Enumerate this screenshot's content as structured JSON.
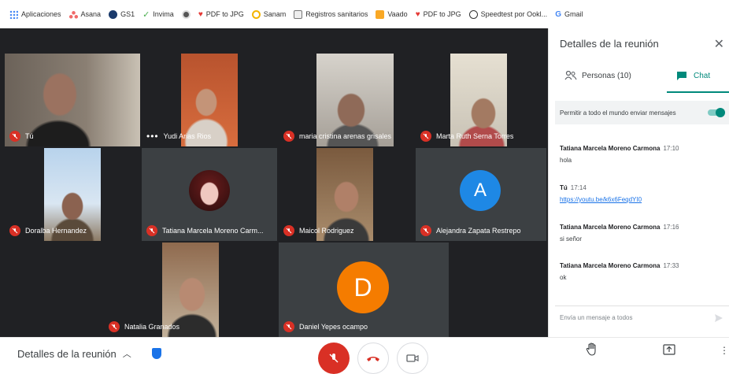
{
  "bookmarks": [
    {
      "label": "Aplicaciones",
      "icon": "apps-grid-icon",
      "color": "#4285f4"
    },
    {
      "label": "Asana",
      "icon": "asana-icon",
      "color": "#f06a6a"
    },
    {
      "label": "GS1",
      "icon": "gs1-icon",
      "color": "#1a3a6b"
    },
    {
      "label": "Invima",
      "icon": "checkmark-icon",
      "color": "#4caf50"
    },
    {
      "label": "",
      "icon": "chrome-icon",
      "color": "#555555"
    },
    {
      "label": "PDF to JPG",
      "icon": "pdf-heart-icon",
      "color": "#e53935"
    },
    {
      "label": "Sanam",
      "icon": "sanam-icon",
      "color": "#f4b400"
    },
    {
      "label": "Registros sanitarios",
      "icon": "document-icon",
      "color": "#777777"
    },
    {
      "label": "Vaado",
      "icon": "vaado-icon",
      "color": "#f9a825"
    },
    {
      "label": "PDF to JPG",
      "icon": "pdf-heart-icon",
      "color": "#e53935"
    },
    {
      "label": "Speedtest por Ookl...",
      "icon": "speedometer-icon",
      "color": "#333333"
    },
    {
      "label": "Gmail",
      "icon": "google-icon",
      "color": "#4285f4"
    }
  ],
  "participants": [
    {
      "name": "Tú",
      "indicator": "muted"
    },
    {
      "name": "Yudi Arias Rios",
      "indicator": "speaking"
    },
    {
      "name": "maria cristina arenas grisales",
      "indicator": "muted"
    },
    {
      "name": "Marta Ruth Serna Torres",
      "indicator": "muted"
    },
    {
      "name": "Doralba Hernandez",
      "indicator": "muted"
    },
    {
      "name": "Tatiana Marcela Moreno Carm...",
      "indicator": "muted"
    },
    {
      "name": "Maicol Rodriguez",
      "indicator": "muted"
    },
    {
      "name": "Alejandra Zapata Restrepo",
      "indicator": "muted",
      "avatar_letter": "A",
      "avatar_color": "#1e88e5"
    },
    {
      "name": "Natalia Granados",
      "indicator": "muted"
    },
    {
      "name": "Daniel Yepes ocampo",
      "indicator": "muted",
      "avatar_letter": "D",
      "avatar_color": "#f57c00"
    }
  ],
  "panel": {
    "title": "Detalles de la reunión",
    "close": "✕",
    "people_tab": "Personas (10)",
    "chat_tab": "Chat",
    "permit_label": "Permitir a todo el mundo enviar mensajes",
    "permit_enabled": true,
    "messages": [
      {
        "sender": "Tatiana Marcela Moreno Carmona",
        "time": "17:10",
        "text": "hola"
      },
      {
        "sender": "Tú",
        "time": "17:14",
        "link": "https://youtu.be/k6x6FeqdYI0"
      },
      {
        "sender": "Tatiana Marcela Moreno Carmona",
        "time": "17:16",
        "text": "si señor"
      },
      {
        "sender": "Tatiana Marcela Moreno Carmona",
        "time": "17:33",
        "text": "ok"
      }
    ],
    "composer_placeholder": "Envía un mensaje a todos"
  },
  "bottom": {
    "meeting_details": "Detalles de la reunión",
    "colors": {
      "mic_off": "#d93025",
      "accent": "#00897b"
    }
  }
}
